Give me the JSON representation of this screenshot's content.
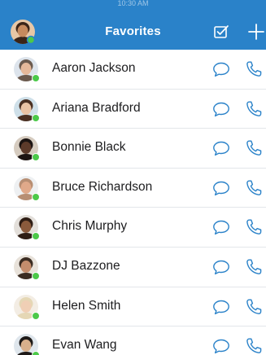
{
  "header": {
    "status_time": "10:30 AM",
    "title": "Favorites",
    "edit_icon": "checkbox-edit-icon",
    "add_icon": "plus-icon",
    "self_avatar": {
      "skin": "#c68a5e",
      "hair": "#3a2418",
      "bg": "#e7c7a6"
    }
  },
  "colors": {
    "accent": "#2a82c9",
    "icon_blue": "#2a82c9",
    "presence_online": "#4cc94a",
    "divider": "#e3e6ea"
  },
  "favorites": [
    {
      "name": "Aaron Jackson",
      "avatar": {
        "skin": "#e5b89a",
        "hair": "#6b5a4e",
        "bg": "#dde4ec"
      },
      "presence": "online"
    },
    {
      "name": "Ariana Bradford",
      "avatar": {
        "skin": "#e9c3a4",
        "hair": "#4a3022",
        "bg": "#cfe0e9"
      },
      "presence": "online"
    },
    {
      "name": "Bonnie Black",
      "avatar": {
        "skin": "#5c3a2a",
        "hair": "#1c1412",
        "bg": "#d6ccc0"
      },
      "presence": "online"
    },
    {
      "name": "Bruce Richardson",
      "avatar": {
        "skin": "#e0a98a",
        "hair": "#b78e73",
        "bg": "#eef0f2"
      },
      "presence": "online"
    },
    {
      "name": "Chris Murphy",
      "avatar": {
        "skin": "#8a5a3c",
        "hair": "#2e1d14",
        "bg": "#e3dfda"
      },
      "presence": "online"
    },
    {
      "name": "DJ Bazzone",
      "avatar": {
        "skin": "#c48d6d",
        "hair": "#3b2c22",
        "bg": "#e8e2da"
      },
      "presence": "online"
    },
    {
      "name": "Helen Smith",
      "avatar": {
        "skin": "#f0cfb5",
        "hair": "#e5d7b5",
        "bg": "#f3ede4"
      },
      "presence": "online"
    },
    {
      "name": "Evan Wang",
      "avatar": {
        "skin": "#d8b08c",
        "hair": "#1e1a18",
        "bg": "#dfe6ec"
      },
      "presence": "online"
    }
  ],
  "row_actions": {
    "message_icon": "chat-bubble-icon",
    "call_icon": "phone-icon"
  }
}
